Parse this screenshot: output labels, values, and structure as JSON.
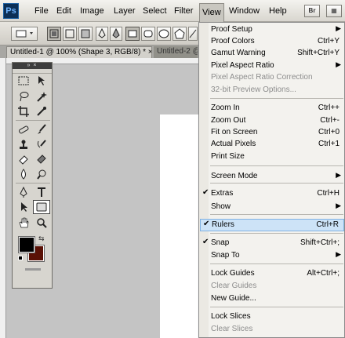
{
  "menubar": {
    "logo": "Ps",
    "items": [
      {
        "label": "File"
      },
      {
        "label": "Edit"
      },
      {
        "label": "Image"
      },
      {
        "label": "Layer"
      },
      {
        "label": "Select"
      },
      {
        "label": "Filter"
      },
      {
        "label": "View"
      },
      {
        "label": "Window"
      },
      {
        "label": "Help"
      }
    ],
    "bridge_label": "Br",
    "minibridge_label": "▦"
  },
  "tabs": {
    "active": "Untitled-1 @ 100% (Shape 3, RGB/8) *",
    "active_close": "×",
    "inactive": "Untitled-2 @"
  },
  "tools": {
    "header": "» ×"
  },
  "colors": {
    "foreground": "#000000",
    "background": "#5a1105",
    "highlight": "#cde3f7"
  },
  "view_menu": {
    "items": [
      {
        "label": "Proof Setup",
        "shortcut": "",
        "submenu": true,
        "enabled": true
      },
      {
        "label": "Proof Colors",
        "shortcut": "Ctrl+Y",
        "enabled": true
      },
      {
        "label": "Gamut Warning",
        "shortcut": "Shift+Ctrl+Y",
        "enabled": true
      },
      {
        "label": "Pixel Aspect Ratio",
        "shortcut": "",
        "submenu": true,
        "enabled": true
      },
      {
        "label": "Pixel Aspect Ratio Correction",
        "shortcut": "",
        "enabled": false
      },
      {
        "label": "32-bit Preview Options...",
        "shortcut": "",
        "enabled": false
      },
      {
        "label": "Zoom In",
        "shortcut": "Ctrl++",
        "enabled": true
      },
      {
        "label": "Zoom Out",
        "shortcut": "Ctrl+-",
        "enabled": true
      },
      {
        "label": "Fit on Screen",
        "shortcut": "Ctrl+0",
        "enabled": true
      },
      {
        "label": "Actual Pixels",
        "shortcut": "Ctrl+1",
        "enabled": true
      },
      {
        "label": "Print Size",
        "shortcut": "",
        "enabled": true
      },
      {
        "label": "Screen Mode",
        "shortcut": "",
        "submenu": true,
        "enabled": true
      },
      {
        "label": "Extras",
        "shortcut": "Ctrl+H",
        "checked": true,
        "enabled": true
      },
      {
        "label": "Show",
        "shortcut": "",
        "submenu": true,
        "enabled": true
      },
      {
        "label": "Rulers",
        "shortcut": "Ctrl+R",
        "checked": true,
        "highlighted": true,
        "enabled": true
      },
      {
        "label": "Snap",
        "shortcut": "Shift+Ctrl+;",
        "checked": true,
        "enabled": true
      },
      {
        "label": "Snap To",
        "shortcut": "",
        "submenu": true,
        "enabled": true
      },
      {
        "label": "Lock Guides",
        "shortcut": "Alt+Ctrl+;",
        "enabled": true
      },
      {
        "label": "Clear Guides",
        "shortcut": "",
        "enabled": false
      },
      {
        "label": "New Guide...",
        "shortcut": "",
        "enabled": true
      },
      {
        "label": "Lock Slices",
        "shortcut": "",
        "enabled": true
      },
      {
        "label": "Clear Slices",
        "shortcut": "",
        "enabled": false
      }
    ],
    "check_glyph": "✔",
    "submenu_glyph": "▶"
  }
}
